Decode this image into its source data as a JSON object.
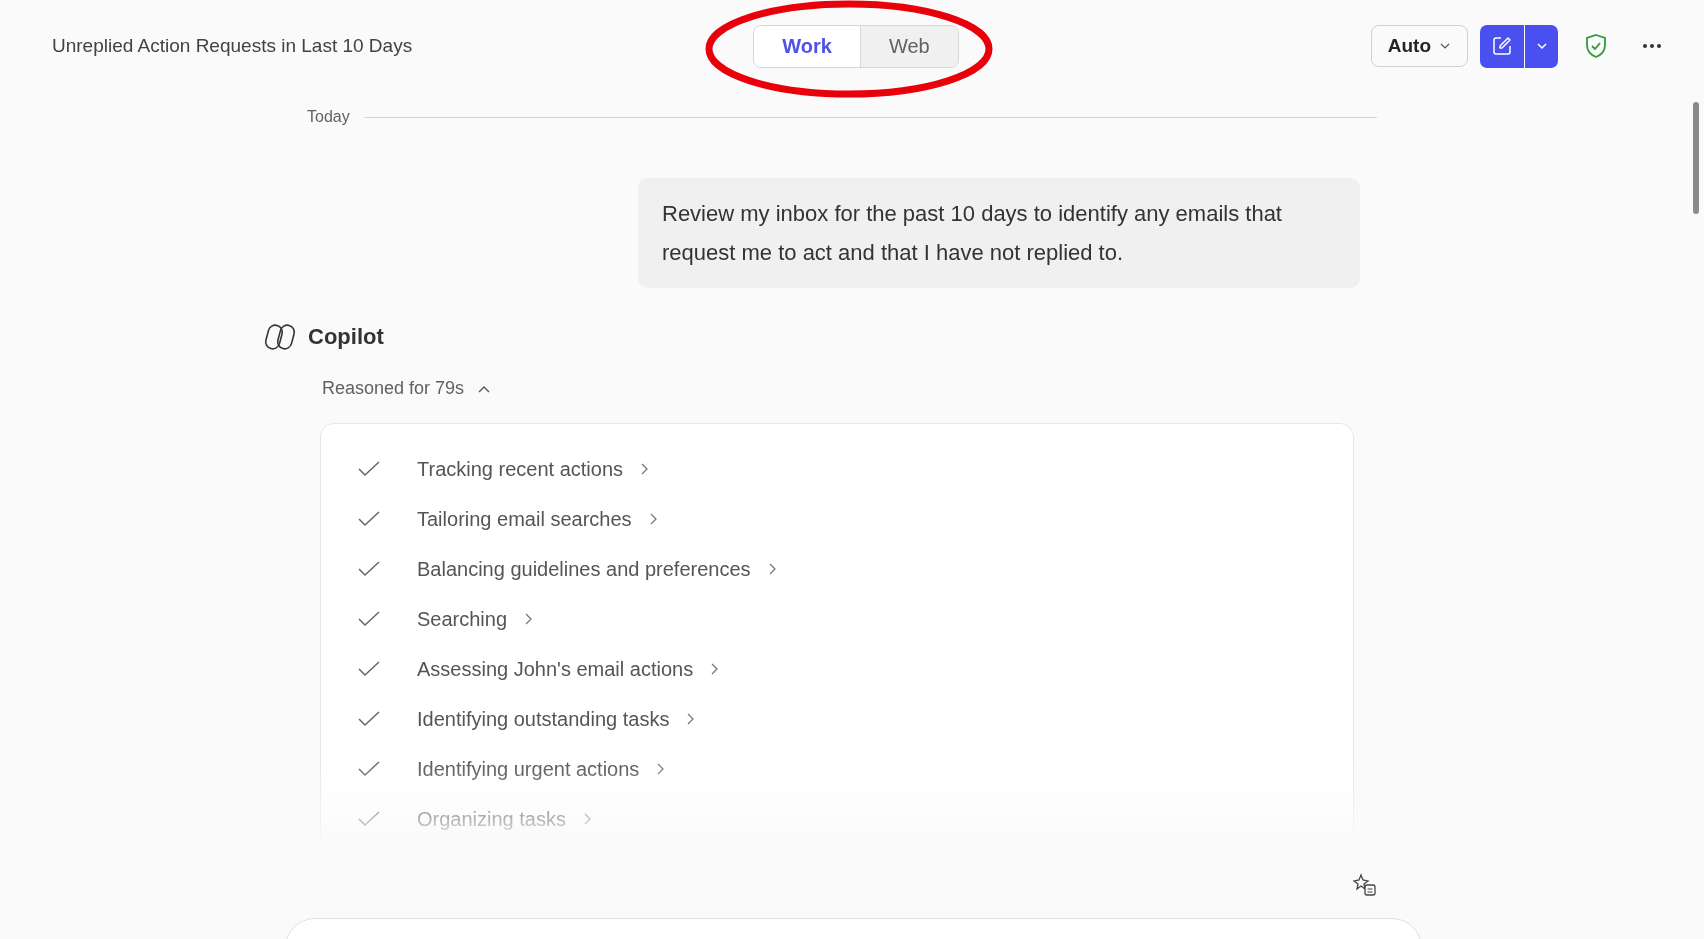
{
  "header": {
    "title": "Unreplied Action Requests in Last 10 Days",
    "tabs": [
      {
        "label": "Work",
        "selected": true
      },
      {
        "label": "Web",
        "selected": false
      }
    ],
    "model_button": {
      "label": "Auto"
    }
  },
  "conversation": {
    "date_divider": "Today",
    "user_message": "Review my inbox for the past 10 days to identify any emails that request me to act and that I have not replied to.",
    "assistant": {
      "name": "Copilot",
      "reasoning": {
        "label": "Reasoned for 79s",
        "expanded": true,
        "steps": [
          {
            "label": "Tracking recent actions",
            "done": true
          },
          {
            "label": "Tailoring email searches",
            "done": true
          },
          {
            "label": "Balancing guidelines and preferences",
            "done": true
          },
          {
            "label": "Searching",
            "done": true
          },
          {
            "label": "Assessing John's email actions",
            "done": true
          },
          {
            "label": "Identifying outstanding tasks",
            "done": true
          },
          {
            "label": "Identifying urgent actions",
            "done": true
          },
          {
            "label": "Organizing tasks",
            "done": true
          }
        ]
      }
    }
  }
}
